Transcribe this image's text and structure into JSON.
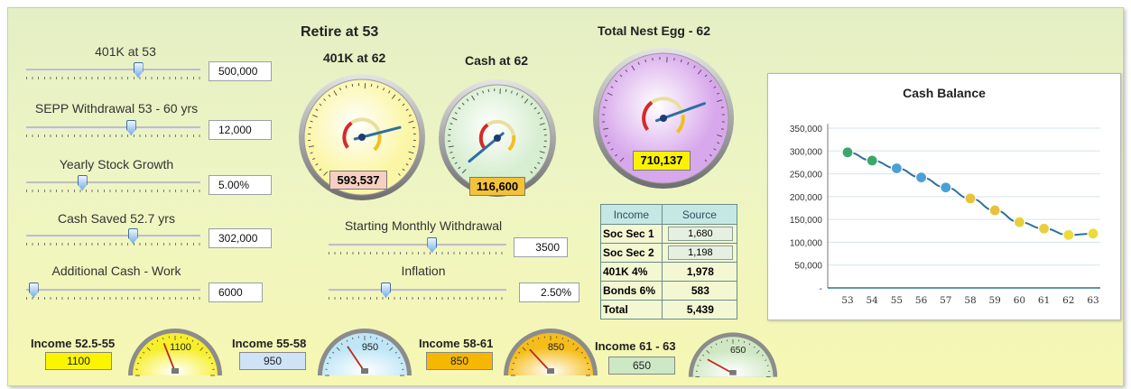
{
  "sliders": [
    {
      "label": "401K at 53",
      "value": "500,000",
      "fraction": 0.64
    },
    {
      "label": "SEPP Withdrawal 53 - 60 yrs",
      "value": "12,000",
      "fraction": 0.6
    },
    {
      "label": "Yearly Stock Growth",
      "value": "5.00%",
      "fraction": 0.32
    },
    {
      "label": "Cash Saved 52.7 yrs",
      "value": "302,000",
      "fraction": 0.61
    },
    {
      "label": "Additional Cash - Work",
      "value": "6000",
      "fraction": 0.04
    }
  ],
  "middle_sliders": [
    {
      "label": "Starting Monthly Withdrawal",
      "value": "3500",
      "fraction": 0.58
    },
    {
      "label": "Inflation",
      "value": "2.50%",
      "fraction": 0.32
    }
  ],
  "headings": {
    "retire": "Retire at 53",
    "k401": "401K at 62",
    "cash": "Cash at 62",
    "total": "Total Nest Egg - 62"
  },
  "gauges": {
    "k401": {
      "readout": "593,537",
      "face": "#fbf6a6",
      "readout_bg": "#f6cfc2",
      "needle_fraction": 0.78
    },
    "cash": {
      "readout": "116,600",
      "face": "#d7eed0",
      "readout_bg": "#f4c23a",
      "needle_fraction": 0.02
    },
    "total": {
      "readout": "710,137",
      "face": "#d8a8ec",
      "readout_bg": "#fbf200",
      "needle_fraction": 0.76
    }
  },
  "income_table": {
    "headers": [
      "Income",
      "Source"
    ],
    "rows": [
      {
        "label": "Soc Sec 1",
        "value": "1,680",
        "boxed": true
      },
      {
        "label": "Soc Sec  2",
        "value": "1,198",
        "boxed": true
      },
      {
        "label": "401K 4%",
        "value": "1,978",
        "boxed": false
      },
      {
        "label": "Bonds 6%",
        "value": "583",
        "boxed": false
      },
      {
        "label": "Total",
        "value": "5,439",
        "boxed": false
      }
    ]
  },
  "chart_data": {
    "type": "line",
    "title": "Cash Balance",
    "xlabel": "",
    "ylabel": "",
    "x": [
      "53",
      "54",
      "55",
      "56",
      "57",
      "58",
      "59",
      "60",
      "61",
      "62",
      "63"
    ],
    "series": [
      {
        "values": [
          297000,
          279000,
          262000,
          242000,
          220000,
          196000,
          170000,
          144000,
          130000,
          116000,
          119000
        ]
      }
    ],
    "ylim": [
      0,
      350000
    ],
    "yticks": [
      "350,000",
      "300,000",
      "250,000",
      "200,000",
      "150,000",
      "100,000",
      "50,000",
      "-"
    ],
    "grid": true,
    "legend": "none",
    "line_color": "#2e6f9e"
  },
  "mini_gauges": [
    {
      "label": "Income 52.5-55",
      "value": "1100",
      "box_color": "#fbf500",
      "face": "#f7ef2a",
      "needle_fraction": 0.62
    },
    {
      "label": "Income 55-58",
      "value": "950",
      "box_color": "#cfe3f7",
      "face": "#bfe6f6",
      "needle_fraction": 0.55
    },
    {
      "label": "Income 58-61",
      "value": "850",
      "box_color": "#f6b700",
      "face": "#f6bd1a",
      "needle_fraction": 0.5
    },
    {
      "label": "Income 61 - 63",
      "value": "650",
      "box_color": "#cde8c4",
      "face": "#cfe8c3",
      "needle_fraction": 0.4
    }
  ]
}
